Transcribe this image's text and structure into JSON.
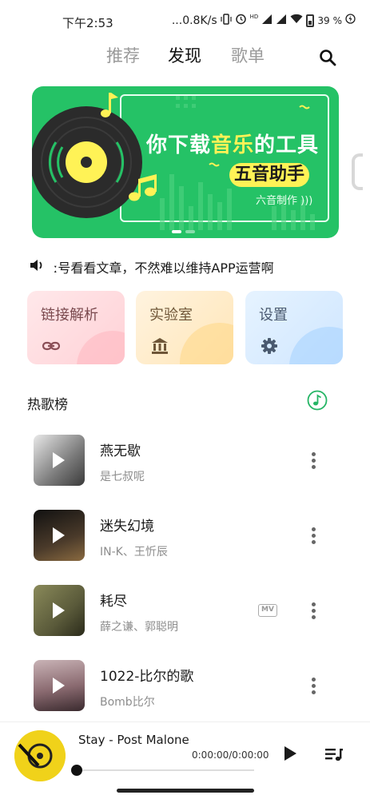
{
  "status_bar": {
    "time": "下午2:53",
    "network_speed": "...0.8K/s",
    "hd_label": "HD",
    "battery_percent": "39"
  },
  "nav": {
    "tabs": [
      {
        "label": "推荐",
        "active": false
      },
      {
        "label": "发现",
        "active": true
      },
      {
        "label": "歌单",
        "active": false
      }
    ],
    "search_icon": "search-icon"
  },
  "banner": {
    "headline_prefix": "你下载",
    "headline_accent": "音乐",
    "headline_suffix": "的工具",
    "subtitle": "五音助手",
    "credit": "六音制作",
    "colors": {
      "background": "#25c266",
      "accent": "#fff256"
    }
  },
  "notice": {
    "icon": "speaker-icon",
    "text": "ː号看看文章，不然难以维持APP运营啊"
  },
  "features": [
    {
      "label": "链接解析",
      "icon": "link-icon"
    },
    {
      "label": "实验室",
      "icon": "bank-icon"
    },
    {
      "label": "设置",
      "icon": "gear-icon"
    }
  ],
  "section": {
    "title": "热歌榜",
    "icon": "music-note-icon"
  },
  "songs": [
    {
      "title": "燕无歇",
      "artist": "是七叔呢",
      "mv": false
    },
    {
      "title": "迷失幻境",
      "artist": "IN-K、王忻辰",
      "mv": false
    },
    {
      "title": "耗尽",
      "artist": "薛之谦、郭聪明",
      "mv": true,
      "mv_label": "MV"
    },
    {
      "title": "1022-比尔的歌",
      "artist": "Bomb比尔",
      "mv": false
    }
  ],
  "player": {
    "title": "Stay - Post Malone",
    "time": "0:00:00/0:00:00",
    "progress": 0
  }
}
